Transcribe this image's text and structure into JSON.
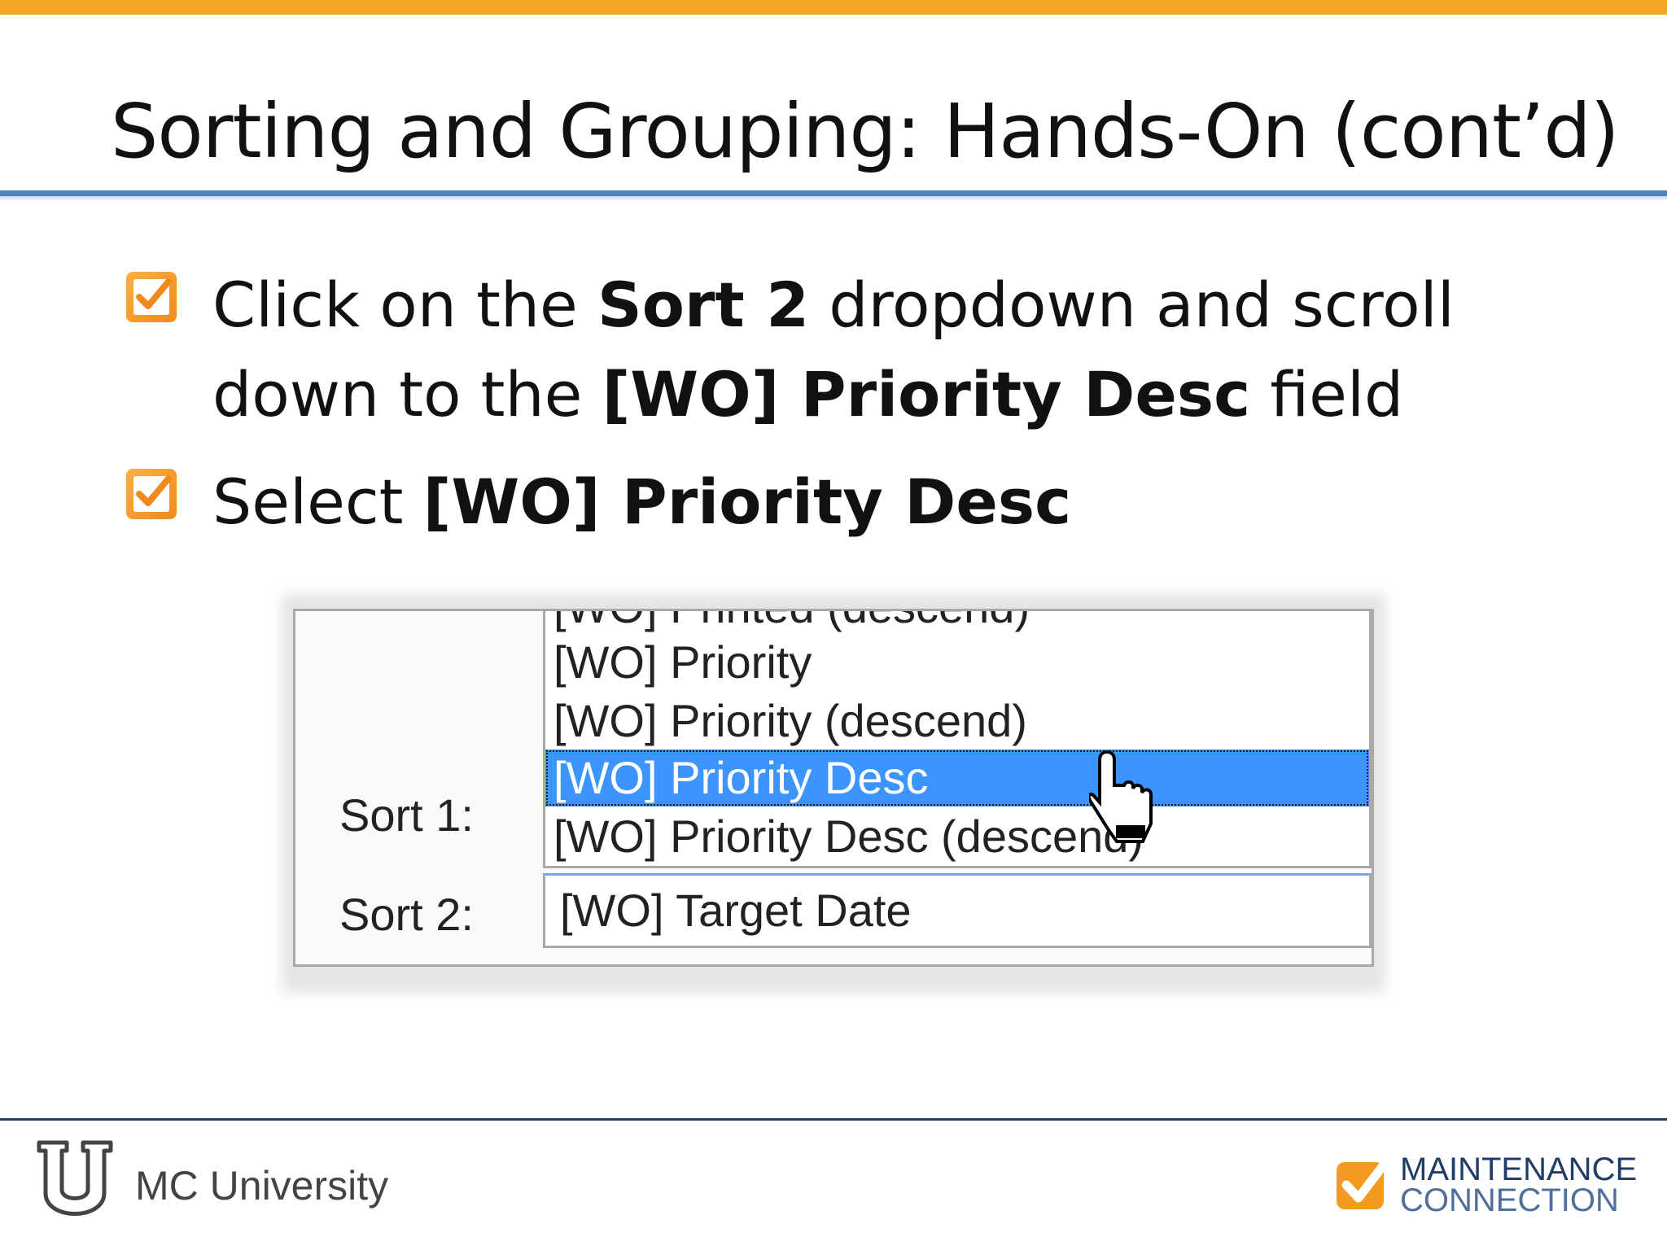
{
  "slide": {
    "title": "Sorting and Grouping: Hands-On (cont’d)"
  },
  "bullets": [
    {
      "pre": "Click on the ",
      "bold1": "Sort 2",
      "mid": " dropdown and scroll",
      "line2_pre": "down to the ",
      "bold2": "[WO] Priority Desc",
      "post": " field"
    },
    {
      "pre": "Select ",
      "bold1": "[WO] Priority Desc"
    }
  ],
  "screenshot": {
    "sort1_label": "Sort 1:",
    "sort2_label": "Sort 2:",
    "list_items": [
      "[WO] Printed (descend)",
      "[WO] Priority",
      "[WO] Priority (descend)",
      "[WO] Priority Desc",
      "[WO] Priority Desc (descend)"
    ],
    "selected_index": 3,
    "sort2_value": "[WO] Target Date",
    "highlight_color": "#3c94ff"
  },
  "footer": {
    "left_text": "MC University",
    "logo_line1": "MAINTENANCE",
    "logo_line2": "CONNECTION"
  },
  "colors": {
    "accent_orange": "#f5a623",
    "title_rule_blue": "#4f81bd",
    "footer_navy": "#1f3d66"
  }
}
